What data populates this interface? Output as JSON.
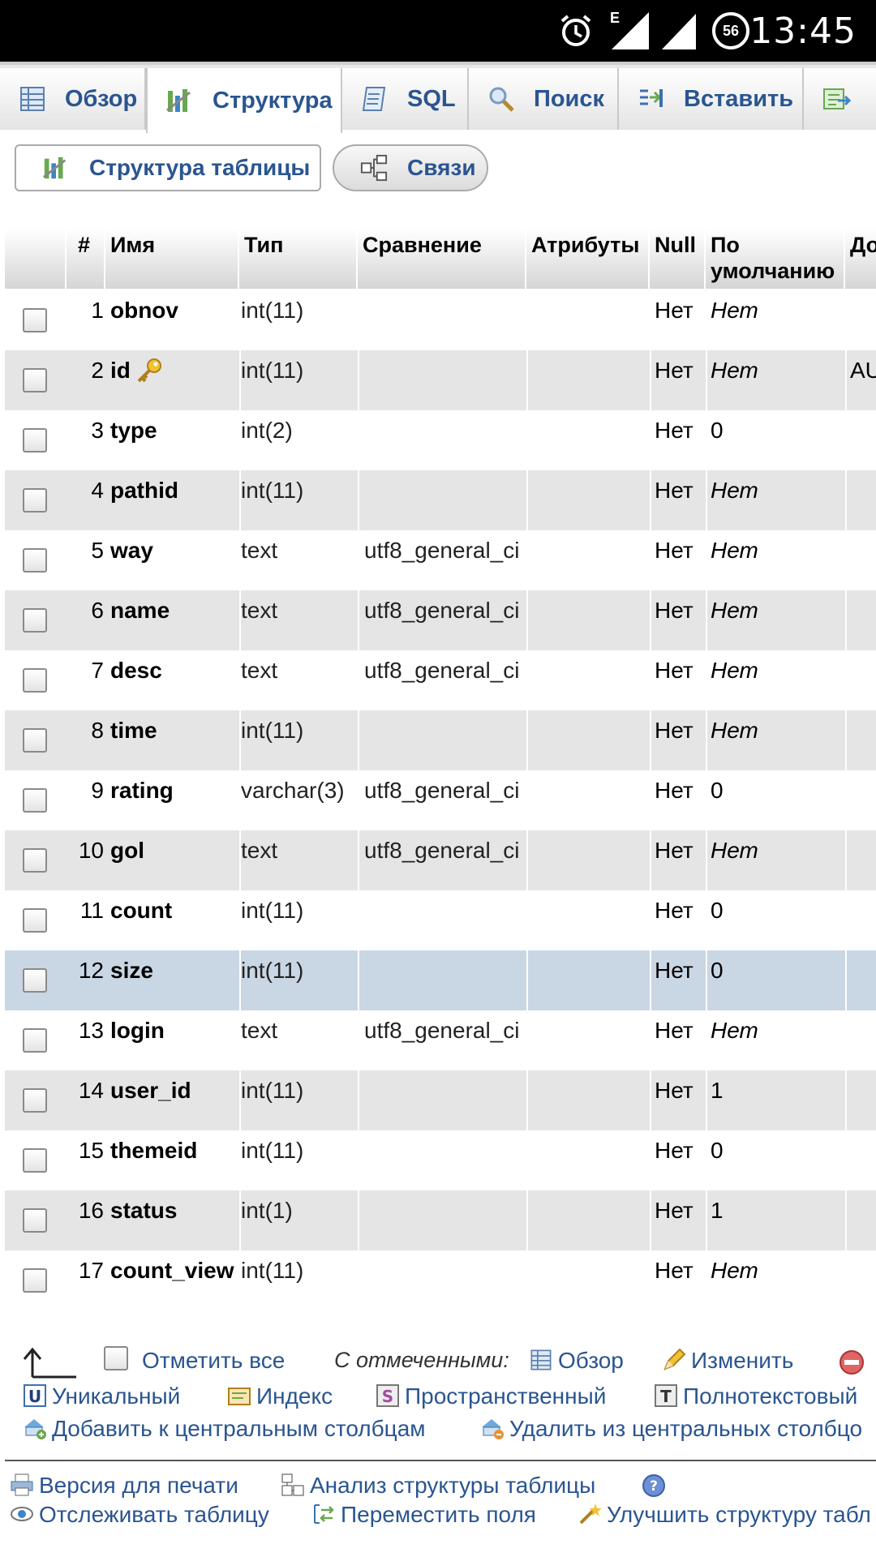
{
  "status_bar": {
    "time": "13:45",
    "network_letter": "E",
    "battery_level": "56"
  },
  "tabs": [
    {
      "label": "Обзор",
      "icon": "browse-icon"
    },
    {
      "label": "Структура",
      "icon": "structure-icon",
      "active": true
    },
    {
      "label": "SQL",
      "icon": "sql-icon"
    },
    {
      "label": "Поиск",
      "icon": "search-icon"
    },
    {
      "label": "Вставить",
      "icon": "insert-icon"
    }
  ],
  "subtabs": {
    "structure": "Структура таблицы",
    "relations": "Связи"
  },
  "table": {
    "headers": {
      "num": "#",
      "name": "Имя",
      "type": "Тип",
      "collation": "Сравнение",
      "attributes": "Атрибуты",
      "null": "Null",
      "default_line1": "По",
      "default_line2": "умолчанию",
      "extra": "До"
    },
    "rows": [
      {
        "num": "1",
        "name": "obnov",
        "type": "int(11)",
        "collation": "",
        "null": "Нет",
        "default": "Нет",
        "extra": ""
      },
      {
        "num": "2",
        "name": "id",
        "type": "int(11)",
        "collation": "",
        "null": "Нет",
        "default": "Нет",
        "extra": "AU",
        "primary_key": true
      },
      {
        "num": "3",
        "name": "type",
        "type": "int(2)",
        "collation": "",
        "null": "Нет",
        "default": "0",
        "extra": ""
      },
      {
        "num": "4",
        "name": "pathid",
        "type": "int(11)",
        "collation": "",
        "null": "Нет",
        "default": "Нет",
        "extra": ""
      },
      {
        "num": "5",
        "name": "way",
        "type": "text",
        "collation": "utf8_general_ci",
        "null": "Нет",
        "default": "Нет",
        "extra": ""
      },
      {
        "num": "6",
        "name": "name",
        "type": "text",
        "collation": "utf8_general_ci",
        "null": "Нет",
        "default": "Нет",
        "extra": ""
      },
      {
        "num": "7",
        "name": "desc",
        "type": "text",
        "collation": "utf8_general_ci",
        "null": "Нет",
        "default": "Нет",
        "extra": ""
      },
      {
        "num": "8",
        "name": "time",
        "type": "int(11)",
        "collation": "",
        "null": "Нет",
        "default": "Нет",
        "extra": ""
      },
      {
        "num": "9",
        "name": "rating",
        "type": "varchar(3)",
        "collation": "utf8_general_ci",
        "null": "Нет",
        "default": "0",
        "extra": ""
      },
      {
        "num": "10",
        "name": "gol",
        "type": "text",
        "collation": "utf8_general_ci",
        "null": "Нет",
        "default": "Нет",
        "extra": ""
      },
      {
        "num": "11",
        "name": "count",
        "type": "int(11)",
        "collation": "",
        "null": "Нет",
        "default": "0",
        "extra": ""
      },
      {
        "num": "12",
        "name": "size",
        "type": "int(11)",
        "collation": "",
        "null": "Нет",
        "default": "0",
        "extra": "",
        "highlighted": true
      },
      {
        "num": "13",
        "name": "login",
        "type": "text",
        "collation": "utf8_general_ci",
        "null": "Нет",
        "default": "Нет",
        "extra": ""
      },
      {
        "num": "14",
        "name": "user_id",
        "type": "int(11)",
        "collation": "",
        "null": "Нет",
        "default": "1",
        "extra": ""
      },
      {
        "num": "15",
        "name": "themeid",
        "type": "int(11)",
        "collation": "",
        "null": "Нет",
        "default": "0",
        "extra": ""
      },
      {
        "num": "16",
        "name": "status",
        "type": "int(1)",
        "collation": "",
        "null": "Нет",
        "default": "1",
        "extra": ""
      },
      {
        "num": "17",
        "name": "count_view",
        "type": "int(11)",
        "collation": "",
        "null": "Нет",
        "default": "Нет",
        "extra": ""
      }
    ]
  },
  "bulk": {
    "check_all": "Отметить все",
    "with_selected": "С отмеченными:",
    "browse": "Обзор",
    "change": "Изменить",
    "unique": "Уникальный",
    "index": "Индекс",
    "spatial": "Пространственный",
    "fulltext": "Полнотекстовый",
    "add_central": "Добавить к центральным столбцам",
    "remove_central": "Удалить из центральных столбцо"
  },
  "footer": {
    "print_view": "Версия для печати",
    "analyze": "Анализ структуры таблицы",
    "track": "Отслеживать таблицу",
    "move_columns": "Переместить поля",
    "improve": "Улучшить структуру табл"
  },
  "colors": {
    "link": "#2a5590",
    "highlight_row": "#c9d6e4",
    "even_row": "#e5e5e5"
  }
}
